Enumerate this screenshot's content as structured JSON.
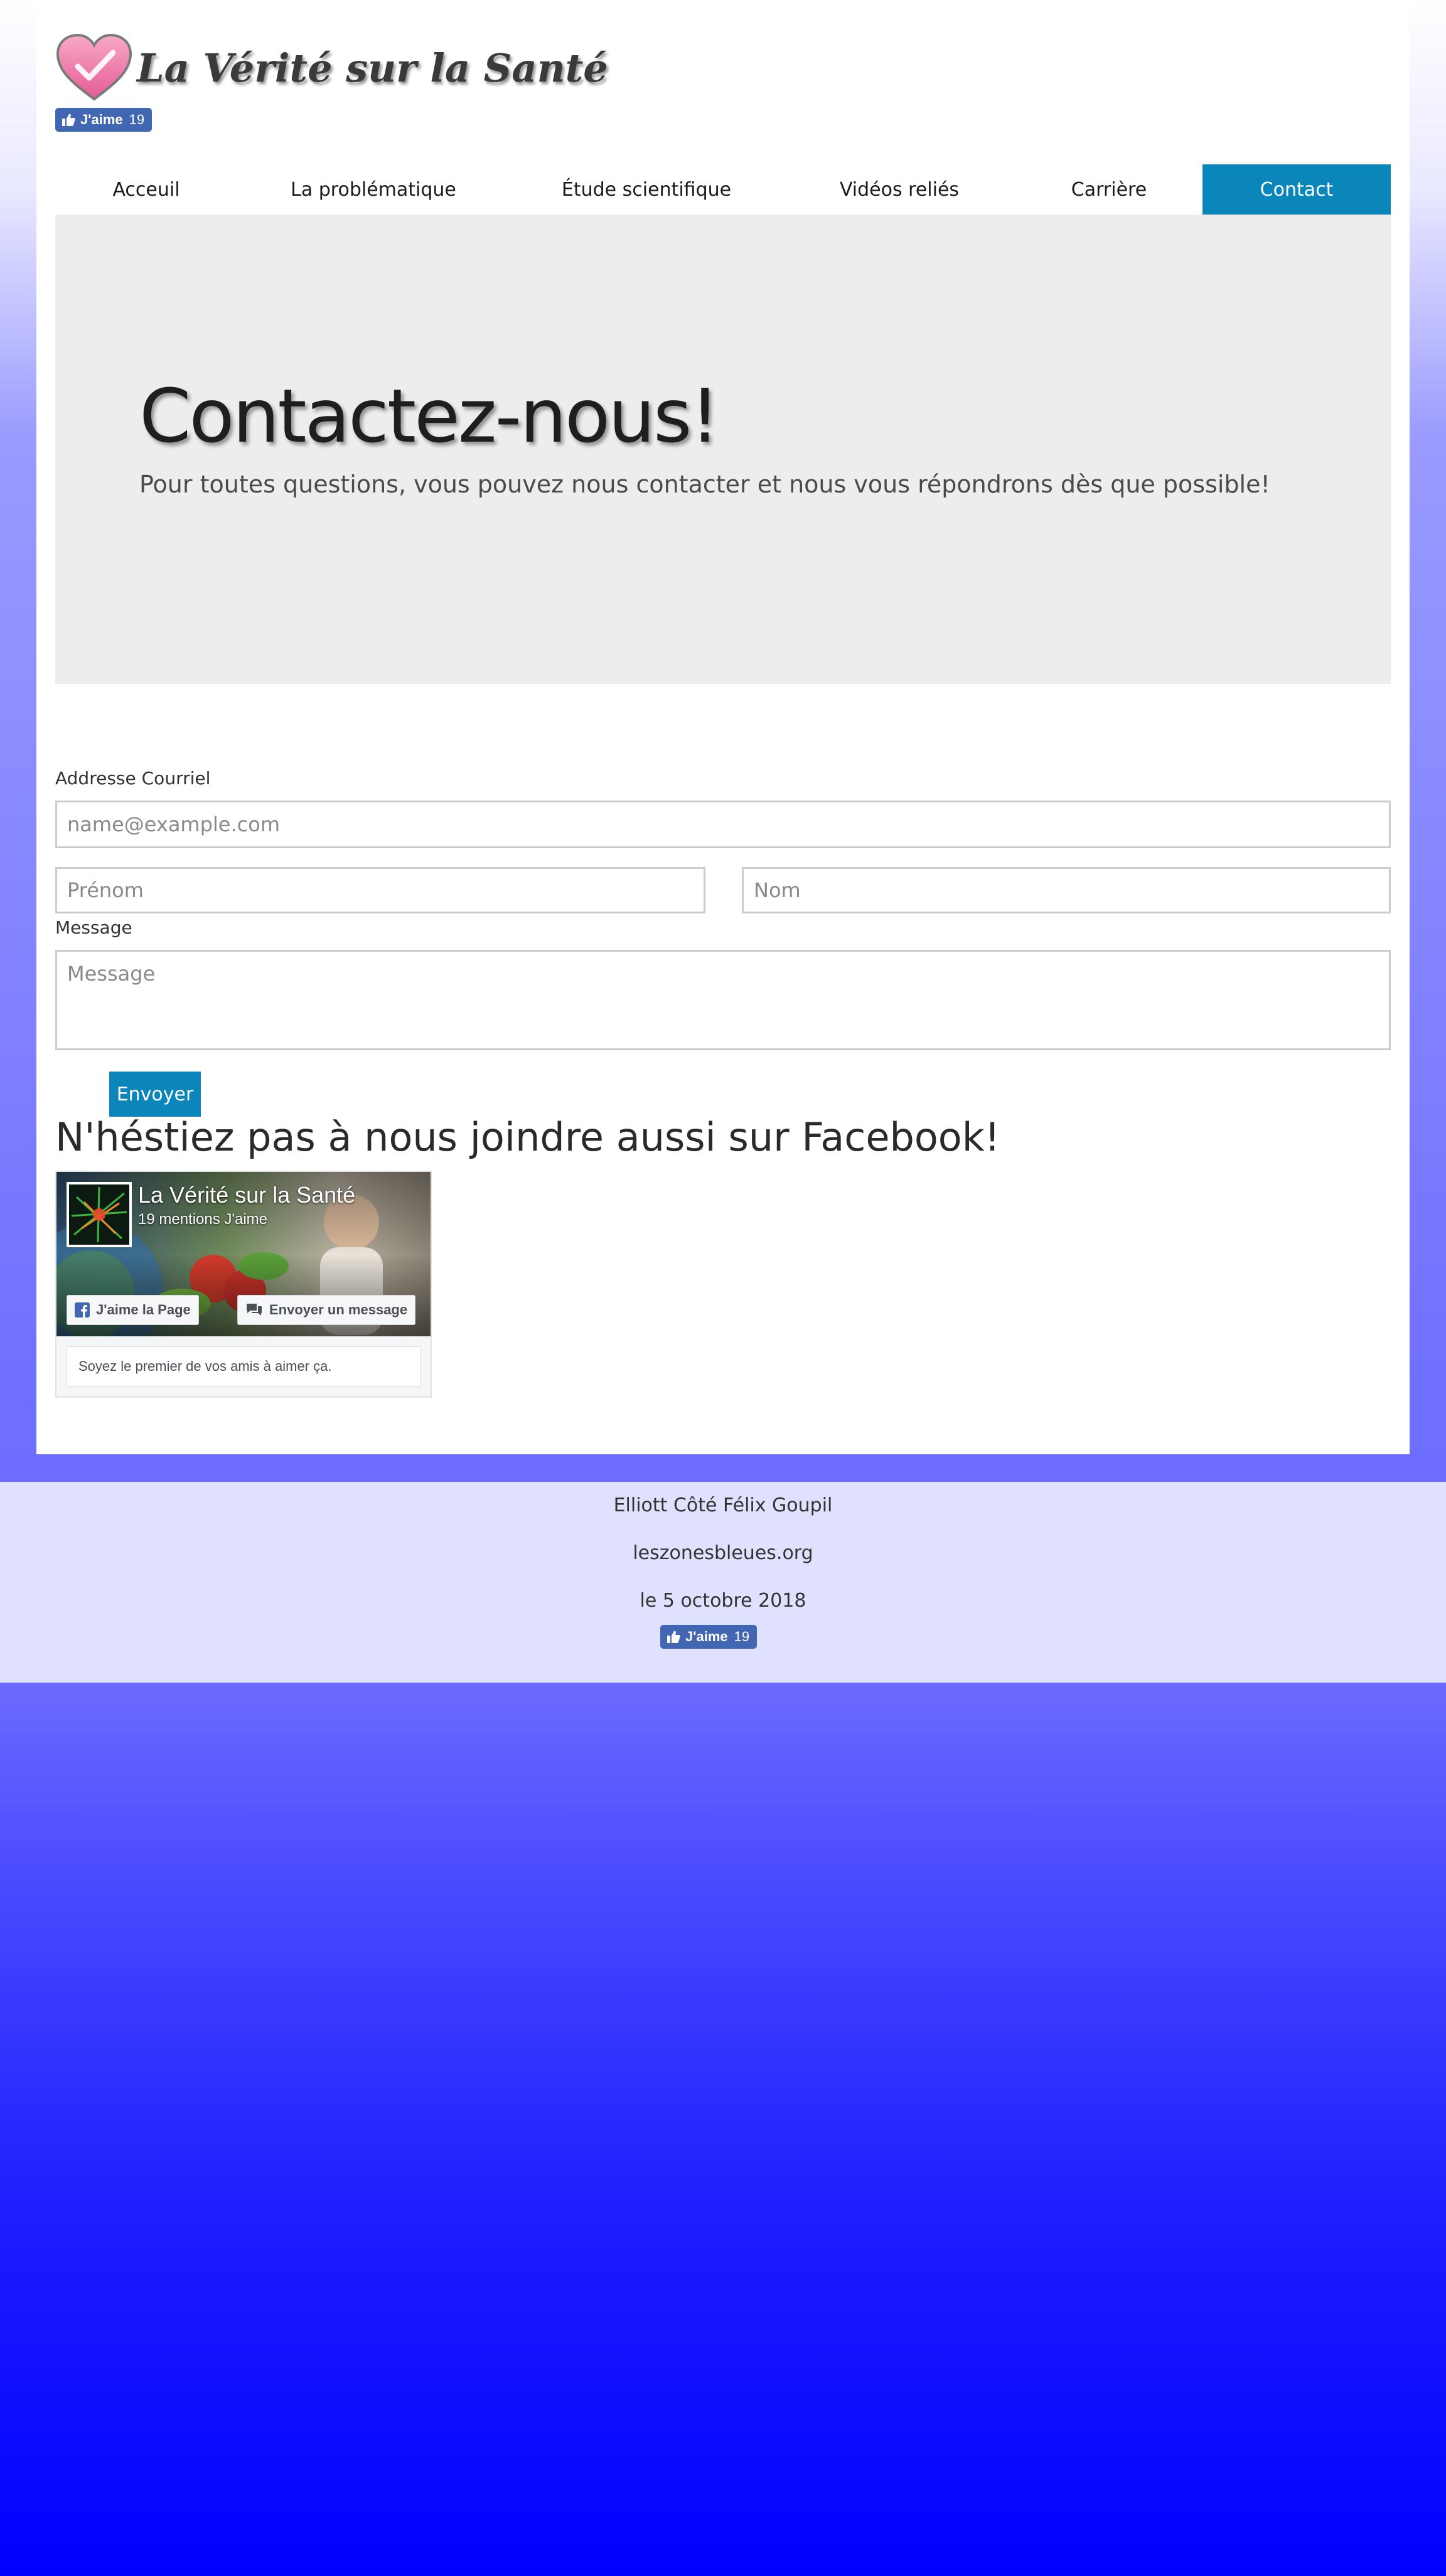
{
  "header": {
    "site_title": "La Vérité sur la Santé",
    "logo_icon": "heart-check-icon",
    "like_label": "J'aime",
    "like_count": "19"
  },
  "nav": {
    "items": [
      {
        "label": "Acceuil"
      },
      {
        "label": "La problématique"
      },
      {
        "label": "Étude scientifique"
      },
      {
        "label": "Vidéos reliés"
      },
      {
        "label": "Carrière"
      },
      {
        "label": "Contact",
        "active": true
      }
    ]
  },
  "hero": {
    "title": "Contactez-nous!",
    "subtitle": "Pour toutes questions, vous pouvez nous contacter et nous vous répondrons dès que possible!"
  },
  "form": {
    "email_label": "Addresse Courriel",
    "email_placeholder": "name@example.com",
    "firstname_placeholder": "Prénom",
    "lastname_placeholder": "Nom",
    "message_label": "Message",
    "message_placeholder": "Message",
    "submit_label": "Envoyer"
  },
  "facebook": {
    "heading": "N'héstiez pas à nous joindre aussi sur Facebook!",
    "page_name": "La Vérité sur la Santé",
    "likes_text": "19 mentions J'aime",
    "like_page_label": "J'aime la Page",
    "message_label": "Envoyer un message",
    "friends_text": "Soyez le premier de vos amis à aimer ça."
  },
  "footer": {
    "authors": "Elliott Côté Félix Goupil",
    "site": "leszonesbleues.org",
    "date": "le 5 octobre 2018",
    "like_label": "J'aime",
    "like_count": "19"
  },
  "colors": {
    "accent": "#0b86bb",
    "facebook_blue": "#4267b2",
    "hero_bg": "#ededed",
    "footer_bg": "#e0e0ff",
    "page_gradient_bottom": "#0000ff"
  }
}
